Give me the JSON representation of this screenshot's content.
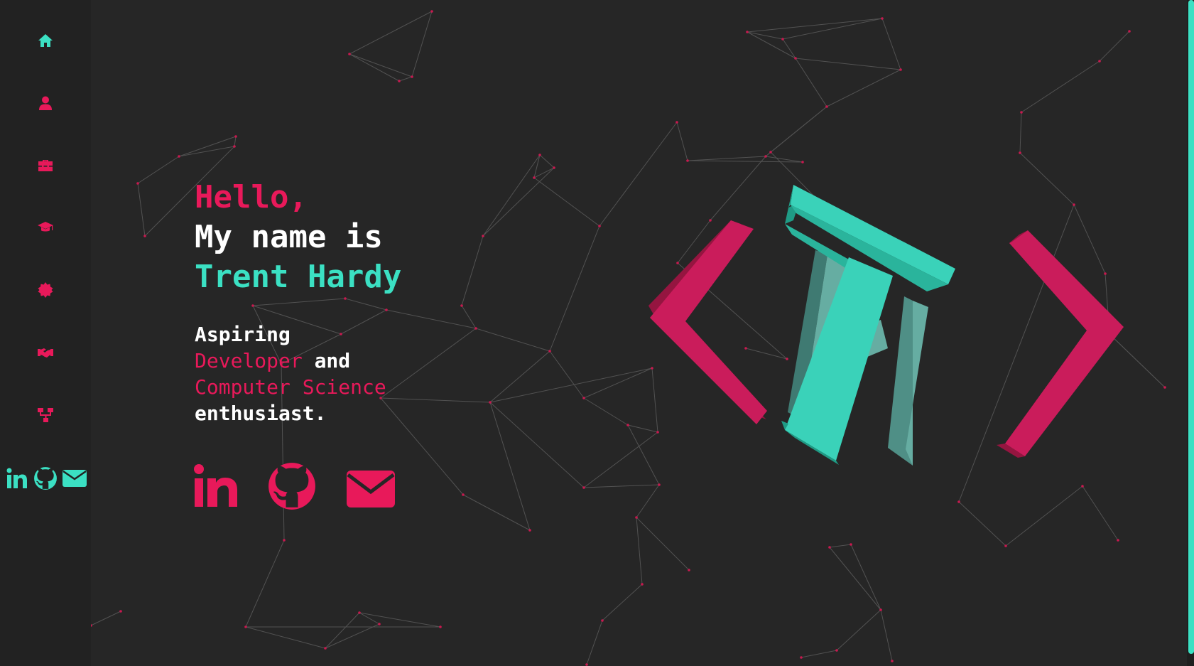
{
  "colors": {
    "background": "#262626",
    "sidebar": "#222222",
    "accent_pink": "#e8195a",
    "accent_teal": "#3be0c3",
    "text_white": "#ffffff"
  },
  "sidebar": {
    "items": [
      {
        "icon": "home-icon",
        "active": true
      },
      {
        "icon": "user-icon"
      },
      {
        "icon": "toolbox-icon"
      },
      {
        "icon": "graduation-cap-icon"
      },
      {
        "icon": "badge-icon"
      },
      {
        "icon": "handshake-icon"
      },
      {
        "icon": "sitemap-icon"
      }
    ],
    "social": [
      "linkedin-icon",
      "github-icon",
      "envelope-icon"
    ]
  },
  "hero": {
    "greeting": "Hello,",
    "intro": "My name is",
    "name": "Trent Hardy",
    "tag_1": "Aspiring",
    "tag_2_highlight": "Developer",
    "tag_2_rest": " and",
    "tag_3_highlight": "Computer Science",
    "tag_4": "enthusiast."
  },
  "hero_social": [
    "linkedin-icon",
    "github-icon",
    "envelope-icon"
  ],
  "logo": {
    "letters": "HT"
  }
}
